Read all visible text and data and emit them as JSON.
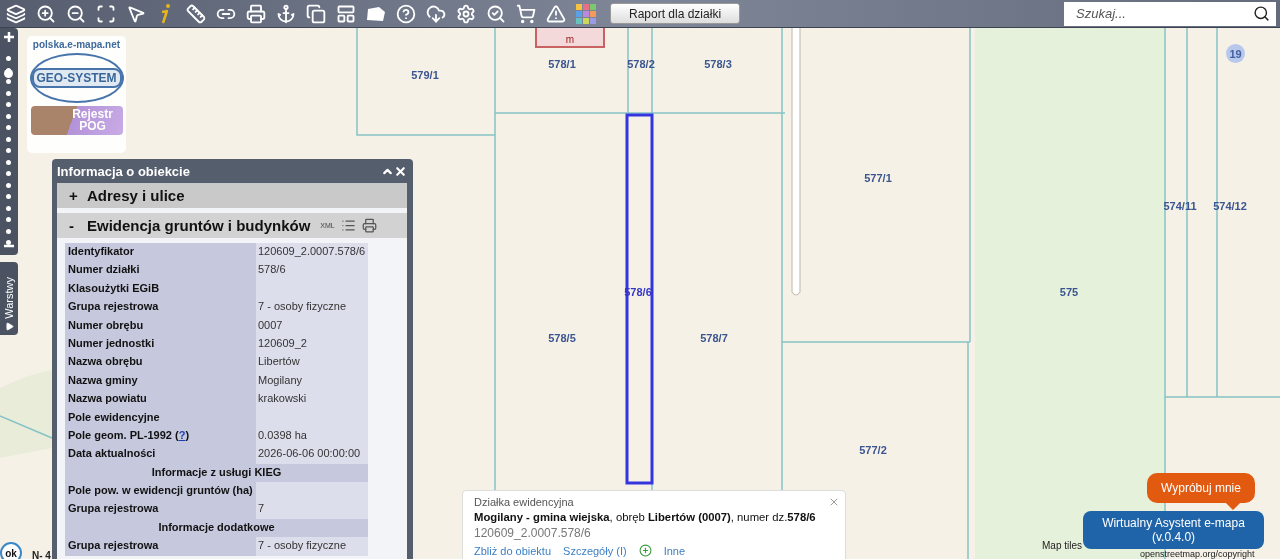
{
  "toolbar": {
    "report_button": "Raport dla działki",
    "search": {
      "placeholder": "Szukaj..."
    }
  },
  "map": {
    "logo": {
      "site": "polska.e-mapa.net",
      "brand": "GEO-SYSTEM",
      "register": "Rejestr POG"
    },
    "layers_tab": "Warstwy",
    "building_label": "m",
    "marker_count": "19",
    "parcels": [
      {
        "label": "579/1",
        "selected": false
      },
      {
        "label": "578/1",
        "selected": false
      },
      {
        "label": "578/2",
        "selected": false
      },
      {
        "label": "578/3",
        "selected": false
      },
      {
        "label": "577/1",
        "selected": false
      },
      {
        "label": "574/11",
        "selected": false
      },
      {
        "label": "574/12",
        "selected": false
      },
      {
        "label": "578/6",
        "selected": true
      },
      {
        "label": "578/5",
        "selected": false
      },
      {
        "label": "578/7",
        "selected": false
      },
      {
        "label": "575",
        "selected": false
      },
      {
        "label": "577/2",
        "selected": false
      }
    ],
    "zoom": {
      "level": 0.8
    },
    "ok_button": "ok",
    "scale_text": "N- 4",
    "attribution": "Map tiles",
    "attribution_link": "openstreetmap.org/copyright"
  },
  "info_panel": {
    "title": "Informacja o obiekcie",
    "sections": [
      {
        "label": "Adresy i ulice",
        "expanded": false,
        "toggle": "+"
      },
      {
        "label": "Ewidencja gruntów i budynków",
        "expanded": true,
        "toggle": "-",
        "xml": "XML"
      }
    ],
    "rows": [
      {
        "kind": "row",
        "label": "Identyfikator",
        "value": "120609_2.0007.578/6"
      },
      {
        "kind": "row",
        "label": "Numer działki",
        "value": "578/6"
      },
      {
        "kind": "row",
        "label": "Klasoużytki EGiB"
      },
      {
        "kind": "row",
        "label": "Grupa rejestrowa",
        "value": "7 - osoby fizyczne"
      },
      {
        "kind": "row",
        "label": "Numer obrębu",
        "value": "0007"
      },
      {
        "kind": "row",
        "label": "Numer jednostki",
        "value": "120609_2"
      },
      {
        "kind": "row",
        "label": "Nazwa obrębu",
        "value": "Libertów"
      },
      {
        "kind": "row",
        "label": "Nazwa gminy",
        "value": "Mogilany"
      },
      {
        "kind": "row",
        "label": "Nazwa powiatu",
        "value": "krakowski"
      },
      {
        "kind": "row",
        "label": "Pole ewidencyjne"
      },
      {
        "kind": "link_row",
        "label": "Pole geom. PL-1992 (",
        "link": "?",
        "label_after": ")",
        "value": "0.0398 ha"
      },
      {
        "kind": "row",
        "label": "Data aktualności",
        "value": "2026-06-06 00:00:00"
      },
      {
        "kind": "header",
        "label": "Informacje z usługi KIEG"
      },
      {
        "kind": "row",
        "label": "Pole pow. w ewidencji gruntów (ha)"
      },
      {
        "kind": "row",
        "label": "Grupa rejestrowa",
        "value": "7"
      },
      {
        "kind": "header",
        "label": "Informacje dodatkowe"
      },
      {
        "kind": "row",
        "label": "Grupa rejestrowa",
        "value": "7 - osoby fizyczne"
      }
    ]
  },
  "popup": {
    "title": "Działka ewidencyjna",
    "description": "**Mogilany - gmina wiejska**, obręb **Libertów (0007)**, numer dz.**578/6**",
    "identifier": "120609_2.0007.578/6",
    "links": [
      "Zbliż do obiektu",
      "Szczegóły (I)",
      "Inne"
    ]
  },
  "assistant": {
    "bubble": "Wypróbuj mnie",
    "button": "Wirtualny Asystent e-mapa (v.0.4.0)"
  }
}
